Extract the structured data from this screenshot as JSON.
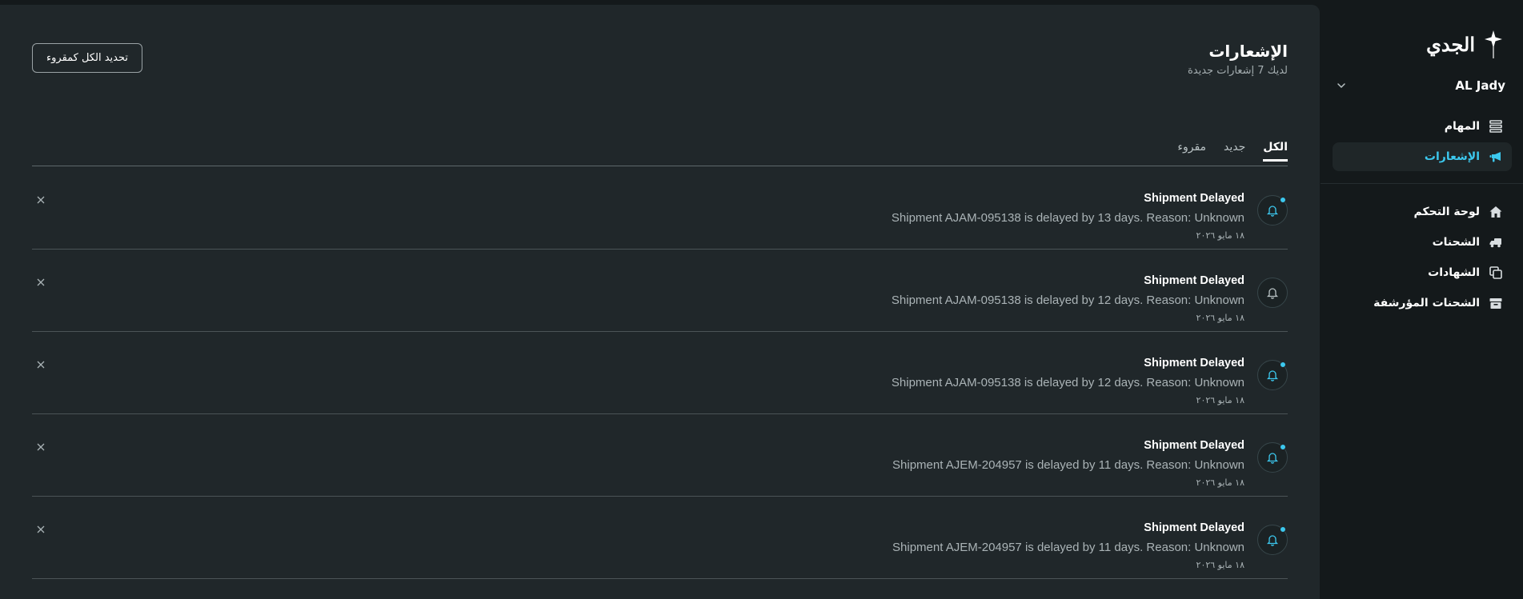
{
  "brand": {
    "name": "الجدي",
    "icon": "sparkle-star-icon"
  },
  "user": {
    "name": "AL Jady"
  },
  "sidebar": {
    "top_items": [
      {
        "label": "المهام",
        "icon": "list-icon",
        "active": false
      },
      {
        "label": "الإشعارات",
        "icon": "megaphone-icon",
        "active": true
      }
    ],
    "items": [
      {
        "label": "لوحة التحكم",
        "icon": "home-icon"
      },
      {
        "label": "الشحنات",
        "icon": "truck-icon"
      },
      {
        "label": "الشهادات",
        "icon": "documents-icon"
      },
      {
        "label": "الشحنات المؤرشفة",
        "icon": "archive-icon"
      }
    ]
  },
  "header": {
    "title": "الإشعارات",
    "subtitle": "لديك 7 إشعارات جديدة",
    "mark_all_label": "تحديد الكل كمقروء"
  },
  "tabs": [
    {
      "label": "الكل",
      "active": true
    },
    {
      "label": "جديد",
      "active": false
    },
    {
      "label": "مقروء",
      "active": false
    }
  ],
  "notifications": [
    {
      "title": "Shipment Delayed",
      "message": "Shipment AJAM-095138 is delayed by 13 days. Reason: Unknown",
      "date": "١٨ مايو ٢٠٢٦",
      "unread": true
    },
    {
      "title": "Shipment Delayed",
      "message": "Shipment AJAM-095138 is delayed by 12 days. Reason: Unknown",
      "date": "١٨ مايو ٢٠٢٦",
      "unread": false
    },
    {
      "title": "Shipment Delayed",
      "message": "Shipment AJAM-095138 is delayed by 12 days. Reason: Unknown",
      "date": "١٨ مايو ٢٠٢٦",
      "unread": true
    },
    {
      "title": "Shipment Delayed",
      "message": "Shipment AJEM-204957 is delayed by 11 days. Reason: Unknown",
      "date": "١٨ مايو ٢٠٢٦",
      "unread": true
    },
    {
      "title": "Shipment Delayed",
      "message": "Shipment AJEM-204957 is delayed by 11 days. Reason: Unknown",
      "date": "١٨ مايو ٢٠٢٦",
      "unread": true
    }
  ],
  "colors": {
    "accent": "#3cc8ee",
    "panel": "#20272a",
    "background": "#14191b"
  }
}
